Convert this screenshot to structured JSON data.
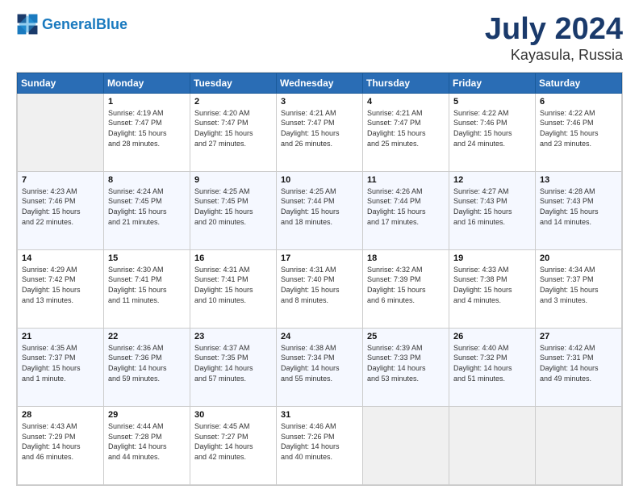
{
  "header": {
    "logo_general": "General",
    "logo_blue": "Blue",
    "main_title": "July 2024",
    "sub_title": "Kayasula, Russia"
  },
  "calendar": {
    "days_of_week": [
      "Sunday",
      "Monday",
      "Tuesday",
      "Wednesday",
      "Thursday",
      "Friday",
      "Saturday"
    ],
    "weeks": [
      [
        {
          "day": "",
          "info": ""
        },
        {
          "day": "1",
          "info": "Sunrise: 4:19 AM\nSunset: 7:47 PM\nDaylight: 15 hours\nand 28 minutes."
        },
        {
          "day": "2",
          "info": "Sunrise: 4:20 AM\nSunset: 7:47 PM\nDaylight: 15 hours\nand 27 minutes."
        },
        {
          "day": "3",
          "info": "Sunrise: 4:21 AM\nSunset: 7:47 PM\nDaylight: 15 hours\nand 26 minutes."
        },
        {
          "day": "4",
          "info": "Sunrise: 4:21 AM\nSunset: 7:47 PM\nDaylight: 15 hours\nand 25 minutes."
        },
        {
          "day": "5",
          "info": "Sunrise: 4:22 AM\nSunset: 7:46 PM\nDaylight: 15 hours\nand 24 minutes."
        },
        {
          "day": "6",
          "info": "Sunrise: 4:22 AM\nSunset: 7:46 PM\nDaylight: 15 hours\nand 23 minutes."
        }
      ],
      [
        {
          "day": "7",
          "info": "Sunrise: 4:23 AM\nSunset: 7:46 PM\nDaylight: 15 hours\nand 22 minutes."
        },
        {
          "day": "8",
          "info": "Sunrise: 4:24 AM\nSunset: 7:45 PM\nDaylight: 15 hours\nand 21 minutes."
        },
        {
          "day": "9",
          "info": "Sunrise: 4:25 AM\nSunset: 7:45 PM\nDaylight: 15 hours\nand 20 minutes."
        },
        {
          "day": "10",
          "info": "Sunrise: 4:25 AM\nSunset: 7:44 PM\nDaylight: 15 hours\nand 18 minutes."
        },
        {
          "day": "11",
          "info": "Sunrise: 4:26 AM\nSunset: 7:44 PM\nDaylight: 15 hours\nand 17 minutes."
        },
        {
          "day": "12",
          "info": "Sunrise: 4:27 AM\nSunset: 7:43 PM\nDaylight: 15 hours\nand 16 minutes."
        },
        {
          "day": "13",
          "info": "Sunrise: 4:28 AM\nSunset: 7:43 PM\nDaylight: 15 hours\nand 14 minutes."
        }
      ],
      [
        {
          "day": "14",
          "info": "Sunrise: 4:29 AM\nSunset: 7:42 PM\nDaylight: 15 hours\nand 13 minutes."
        },
        {
          "day": "15",
          "info": "Sunrise: 4:30 AM\nSunset: 7:41 PM\nDaylight: 15 hours\nand 11 minutes."
        },
        {
          "day": "16",
          "info": "Sunrise: 4:31 AM\nSunset: 7:41 PM\nDaylight: 15 hours\nand 10 minutes."
        },
        {
          "day": "17",
          "info": "Sunrise: 4:31 AM\nSunset: 7:40 PM\nDaylight: 15 hours\nand 8 minutes."
        },
        {
          "day": "18",
          "info": "Sunrise: 4:32 AM\nSunset: 7:39 PM\nDaylight: 15 hours\nand 6 minutes."
        },
        {
          "day": "19",
          "info": "Sunrise: 4:33 AM\nSunset: 7:38 PM\nDaylight: 15 hours\nand 4 minutes."
        },
        {
          "day": "20",
          "info": "Sunrise: 4:34 AM\nSunset: 7:37 PM\nDaylight: 15 hours\nand 3 minutes."
        }
      ],
      [
        {
          "day": "21",
          "info": "Sunrise: 4:35 AM\nSunset: 7:37 PM\nDaylight: 15 hours\nand 1 minute."
        },
        {
          "day": "22",
          "info": "Sunrise: 4:36 AM\nSunset: 7:36 PM\nDaylight: 14 hours\nand 59 minutes."
        },
        {
          "day": "23",
          "info": "Sunrise: 4:37 AM\nSunset: 7:35 PM\nDaylight: 14 hours\nand 57 minutes."
        },
        {
          "day": "24",
          "info": "Sunrise: 4:38 AM\nSunset: 7:34 PM\nDaylight: 14 hours\nand 55 minutes."
        },
        {
          "day": "25",
          "info": "Sunrise: 4:39 AM\nSunset: 7:33 PM\nDaylight: 14 hours\nand 53 minutes."
        },
        {
          "day": "26",
          "info": "Sunrise: 4:40 AM\nSunset: 7:32 PM\nDaylight: 14 hours\nand 51 minutes."
        },
        {
          "day": "27",
          "info": "Sunrise: 4:42 AM\nSunset: 7:31 PM\nDaylight: 14 hours\nand 49 minutes."
        }
      ],
      [
        {
          "day": "28",
          "info": "Sunrise: 4:43 AM\nSunset: 7:29 PM\nDaylight: 14 hours\nand 46 minutes."
        },
        {
          "day": "29",
          "info": "Sunrise: 4:44 AM\nSunset: 7:28 PM\nDaylight: 14 hours\nand 44 minutes."
        },
        {
          "day": "30",
          "info": "Sunrise: 4:45 AM\nSunset: 7:27 PM\nDaylight: 14 hours\nand 42 minutes."
        },
        {
          "day": "31",
          "info": "Sunrise: 4:46 AM\nSunset: 7:26 PM\nDaylight: 14 hours\nand 40 minutes."
        },
        {
          "day": "",
          "info": ""
        },
        {
          "day": "",
          "info": ""
        },
        {
          "day": "",
          "info": ""
        }
      ]
    ]
  }
}
